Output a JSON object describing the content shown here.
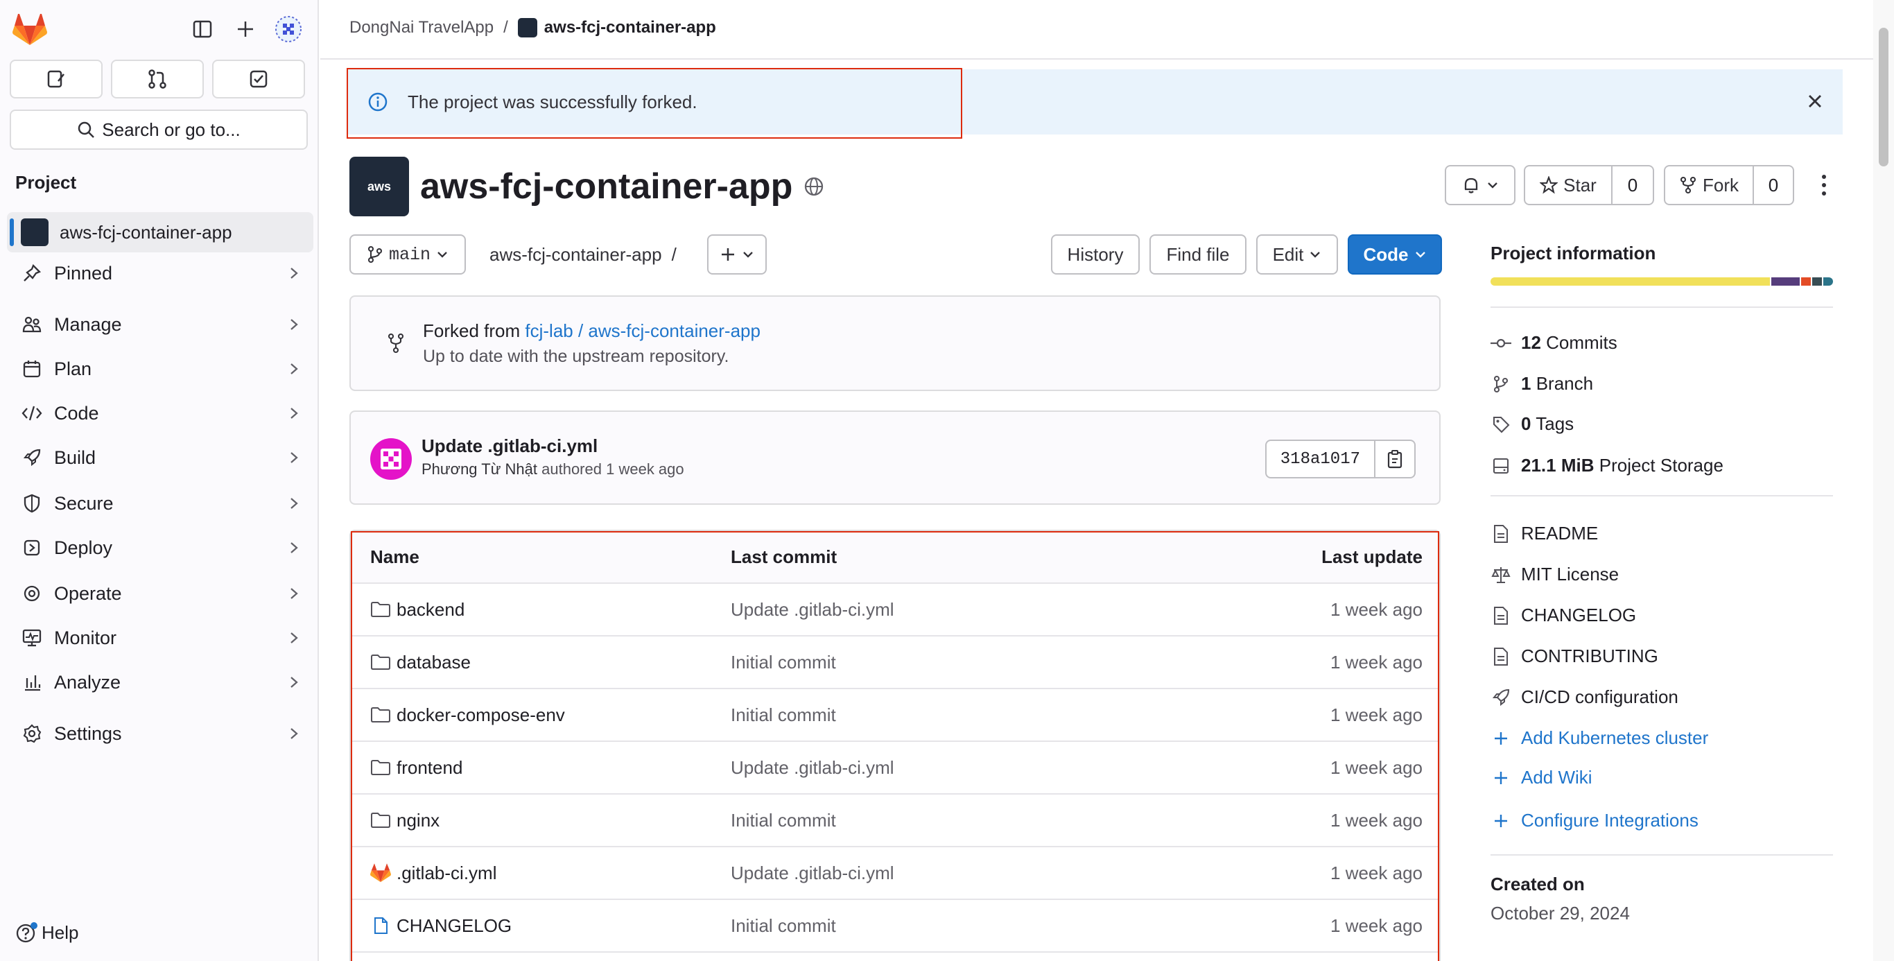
{
  "sidebar": {
    "search_label": "Search or go to...",
    "section_label": "Project",
    "project_name": "aws-fcj-container-app",
    "items": [
      {
        "label": "Pinned"
      },
      {
        "label": "Manage"
      },
      {
        "label": "Plan"
      },
      {
        "label": "Code"
      },
      {
        "label": "Build"
      },
      {
        "label": "Secure"
      },
      {
        "label": "Deploy"
      },
      {
        "label": "Operate"
      },
      {
        "label": "Monitor"
      },
      {
        "label": "Analyze"
      },
      {
        "label": "Settings"
      }
    ],
    "help_label": "Help"
  },
  "breadcrumb": {
    "group": "DongNai TravelApp",
    "separator": "/",
    "project": "aws-fcj-container-app"
  },
  "alert": {
    "message": "The project was successfully forked."
  },
  "project": {
    "title": "aws-fcj-container-app",
    "avatar_text": "aws",
    "star_label": "Star",
    "star_count": "0",
    "fork_label": "Fork",
    "fork_count": "0"
  },
  "toolbar": {
    "branch": "main",
    "path": "aws-fcj-container-app",
    "path_sep": "/",
    "history": "History",
    "find_file": "Find file",
    "edit": "Edit",
    "code": "Code"
  },
  "fork_info": {
    "prefix": "Forked from",
    "source": "fcj-lab / aws-fcj-container-app",
    "status": "Up to date with the upstream repository."
  },
  "last_commit": {
    "message": "Update .gitlab-ci.yml",
    "author": "Phương Từ Nhật",
    "action": "authored",
    "time": "1 week ago",
    "sha": "318a1017"
  },
  "file_table": {
    "headers": {
      "name": "Name",
      "commit": "Last commit",
      "update": "Last update"
    },
    "rows": [
      {
        "name": "backend",
        "type": "folder",
        "commit": "Update .gitlab-ci.yml",
        "update": "1 week ago"
      },
      {
        "name": "database",
        "type": "folder",
        "commit": "Initial commit",
        "update": "1 week ago"
      },
      {
        "name": "docker-compose-env",
        "type": "folder",
        "commit": "Initial commit",
        "update": "1 week ago"
      },
      {
        "name": "frontend",
        "type": "folder",
        "commit": "Update .gitlab-ci.yml",
        "update": "1 week ago"
      },
      {
        "name": "nginx",
        "type": "folder",
        "commit": "Initial commit",
        "update": "1 week ago"
      },
      {
        "name": ".gitlab-ci.yml",
        "type": "gitlab",
        "commit": "Update .gitlab-ci.yml",
        "update": "1 week ago"
      },
      {
        "name": "CHANGELOG",
        "type": "file",
        "commit": "Initial commit",
        "update": "1 week ago"
      }
    ]
  },
  "project_info": {
    "title": "Project information",
    "commits_count": "12",
    "commits_label": "Commits",
    "branch_count": "1",
    "branch_label": "Branch",
    "tags_count": "0",
    "tags_label": "Tags",
    "storage_size": "21.1 MiB",
    "storage_label": "Project Storage",
    "links": [
      "README",
      "MIT License",
      "CHANGELOG",
      "CONTRIBUTING",
      "CI/CD configuration"
    ],
    "actions": [
      "Add Kubernetes cluster",
      "Add Wiki",
      "Configure Integrations"
    ],
    "created_label": "Created on",
    "created_date": "October 29, 2024"
  },
  "colors": {
    "primary": "#1f75cb",
    "highlight_box": "#dd2b0e",
    "alert_bg": "#e9f3fc",
    "lang_bar": [
      "#f1e05a",
      "#563d7c",
      "#e34c26",
      "#384d54",
      "#2b7489"
    ]
  },
  "icons": [
    "gitlab-logo-icon",
    "sidebar-toggle-icon",
    "plus-icon",
    "issues-icon",
    "merge-request-icon",
    "todo-icon",
    "search-icon",
    "info-icon",
    "close-icon",
    "globe-icon",
    "bell-icon",
    "star-icon",
    "fork-icon",
    "kebab-icon",
    "branch-icon",
    "chevron-down-icon",
    "copy-icon",
    "folder-icon",
    "file-icon",
    "commit-icon",
    "tag-icon",
    "storage-icon",
    "license-icon",
    "rocket-icon"
  ]
}
